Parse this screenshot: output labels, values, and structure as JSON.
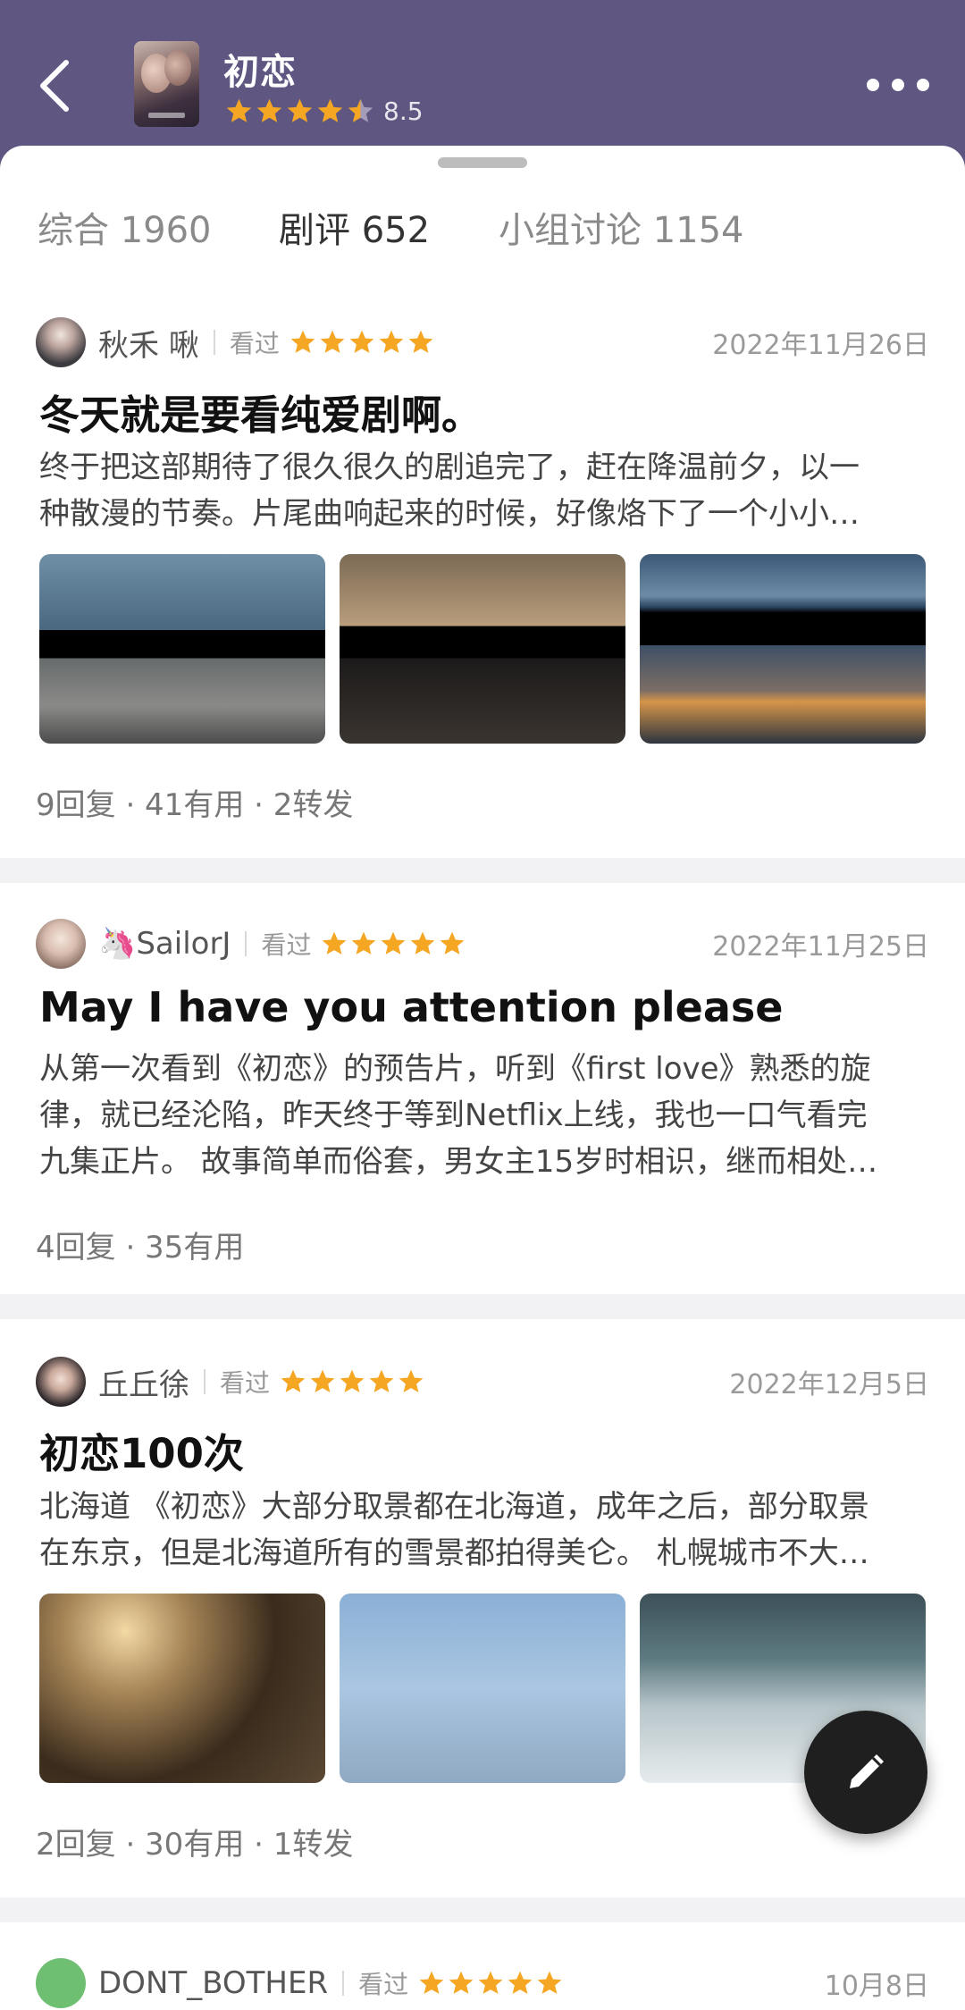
{
  "header": {
    "title": "初恋",
    "rating": 4.5,
    "score": "8.5"
  },
  "tabs": [
    {
      "label": "综合 1960"
    },
    {
      "label": "剧评 652"
    },
    {
      "label": "小组讨论 1154"
    }
  ],
  "reviews": [
    {
      "author": "秋禾 啾",
      "status": "看过",
      "stars": 5,
      "date": "2022年11月26日",
      "title": "冬天就是要看纯爱剧啊。",
      "lines": [
        "终于把这部期待了很久很久的剧追完了，赶在降温前夕，以一",
        "种散漫的节奏。片尾曲响起来的时候，好像烙下了一个小小…"
      ],
      "stats": "9回复 · 41有用 · 2转发"
    },
    {
      "author": "🦄SailorJ",
      "status": "看过",
      "stars": 5,
      "date": "2022年11月25日",
      "title": "May I have you attention please",
      "lines": [
        "从第一次看到《初恋》的预告片，听到《first love》熟悉的旋",
        "律，就已经沦陷，昨天终于等到Netflix上线，我也一口气看完",
        "九集正片。 故事简单而俗套，男女主15岁时相识，继而相处…"
      ],
      "stats": "4回复 · 35有用"
    },
    {
      "author": "丘丘徐",
      "status": "看过",
      "stars": 5,
      "date": "2022年12月5日",
      "title": "初恋100次",
      "lines": [
        "北海道 《初恋》大部分取景都在北海道，成年之后，部分取景",
        "在东京，但是北海道所有的雪景都拍得美仑。 札幌城市不大…"
      ],
      "stats": "2回复 · 30有用 · 1转发"
    },
    {
      "author": "DONT_BOTHER",
      "status": "看过",
      "stars": 5,
      "date": "10月8日"
    }
  ],
  "colors": {
    "header_bg": "#5f5682",
    "star": "#f5a623",
    "fab_bg": "#1f1f1f"
  },
  "icons": {
    "back": "chevron-left-icon",
    "more": "more-horizontal-icon",
    "write": "pencil-icon"
  }
}
